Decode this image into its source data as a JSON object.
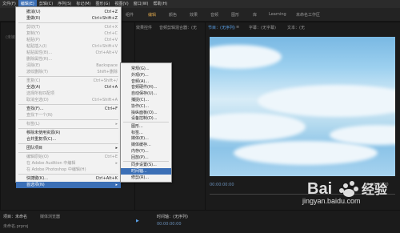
{
  "menubar": [
    "文件(F)",
    "编辑(E)",
    "剪辑(C)",
    "序列(S)",
    "标记(M)",
    "图形(G)",
    "视图(V)",
    "窗口(W)",
    "帮助(H)"
  ],
  "workspace": {
    "tabs": [
      "组件",
      "编辑",
      "颜色",
      "效果",
      "音频",
      "图形",
      "库",
      "Learning",
      "未命名工作区"
    ]
  },
  "panels": {
    "source_tab": "效果控件",
    "audio_mixer_tab": "音频剪辑混合器：(无",
    "program_tab": "节目：(无序列)",
    "program_menu": "≡",
    "subtitle_tab": "字幕：(无字幕)",
    "text_tab": "文本：(无",
    "left_tabs": "(未链接",
    "timecode_left": "00:00:00:00",
    "timecode_right": "00:00:00:00"
  },
  "edit_menu": {
    "items": [
      {
        "label": "撤消(U)",
        "shortcut": "Ctrl+Z",
        "disabled": false
      },
      {
        "label": "重做(R)",
        "shortcut": "Ctrl+Shift+Z",
        "disabled": false
      },
      {
        "sep": true
      },
      {
        "label": "剪切(T)",
        "shortcut": "Ctrl+X",
        "disabled": true
      },
      {
        "label": "复制(Y)",
        "shortcut": "Ctrl+C",
        "disabled": true
      },
      {
        "label": "粘贴(P)",
        "shortcut": "Ctrl+V",
        "disabled": true
      },
      {
        "label": "粘贴插入(I)",
        "shortcut": "Ctrl+Shift+V",
        "disabled": true
      },
      {
        "label": "粘贴属性(B)...",
        "shortcut": "Ctrl+Alt+V",
        "disabled": true
      },
      {
        "label": "删除属性(R)...",
        "shortcut": "",
        "disabled": true
      },
      {
        "label": "清除(E)",
        "shortcut": "Backspace",
        "disabled": true
      },
      {
        "label": "波纹删除(T)",
        "shortcut": "Shift+删除",
        "disabled": true
      },
      {
        "sep": true
      },
      {
        "label": "重复(C)",
        "shortcut": "Ctrl+Shift+/",
        "disabled": true
      },
      {
        "label": "全选(A)",
        "shortcut": "Ctrl+A",
        "disabled": false
      },
      {
        "label": "选择所有匹配项",
        "shortcut": "",
        "disabled": true
      },
      {
        "label": "取消全选(D)",
        "shortcut": "Ctrl+Shift+A",
        "disabled": true
      },
      {
        "sep": true
      },
      {
        "label": "查找(F)...",
        "shortcut": "Ctrl+F",
        "disabled": false
      },
      {
        "label": "查找下一个(N)",
        "shortcut": "",
        "disabled": true
      },
      {
        "sep": true
      },
      {
        "label": "标签(L)",
        "shortcut": "",
        "disabled": true,
        "arrow": true
      },
      {
        "sep": true
      },
      {
        "label": "移除未使用资源(R)",
        "shortcut": "",
        "disabled": false
      },
      {
        "label": "合并重复项(C)...",
        "shortcut": "",
        "disabled": false
      },
      {
        "sep": true
      },
      {
        "label": "团队项目",
        "shortcut": "",
        "disabled": false,
        "arrow": true
      },
      {
        "sep": true
      },
      {
        "label": "编辑原始(O)",
        "shortcut": "Ctrl+E",
        "disabled": true
      },
      {
        "label": "在 Adobe Audition 中编辑",
        "shortcut": "",
        "disabled": true,
        "arrow": true
      },
      {
        "label": "在 Adobe Photoshop 中编辑(H)",
        "shortcut": "",
        "disabled": true
      },
      {
        "sep": true
      },
      {
        "label": "快捷键(K)...",
        "shortcut": "Ctrl+Alt+K",
        "disabled": false
      },
      {
        "label": "首选项(N)",
        "shortcut": "",
        "disabled": false,
        "arrow": true,
        "selected": true
      }
    ]
  },
  "submenu": {
    "items": [
      {
        "label": "常规(G)..."
      },
      {
        "label": "外观(P)..."
      },
      {
        "label": "音频(A)..."
      },
      {
        "label": "音频硬件(H)..."
      },
      {
        "label": "自动保存(U)..."
      },
      {
        "label": "捕捉(C)..."
      },
      {
        "label": "协作(C)..."
      },
      {
        "label": "操纵面板(O)..."
      },
      {
        "label": "设备控制(D)..."
      },
      {
        "label": "图形..."
      },
      {
        "label": "标签..."
      },
      {
        "label": "媒体(E)..."
      },
      {
        "label": "媒体缓存..."
      },
      {
        "label": "内存(Y)..."
      },
      {
        "label": "回放(P)..."
      },
      {
        "label": "同步设置(S)..."
      },
      {
        "label": "时间轴...",
        "selected": true
      },
      {
        "label": "修剪(R)..."
      }
    ]
  },
  "bottom": {
    "project_tab": "项目：未命名",
    "media_tab": "媒体浏览器",
    "project_file": "未命名.prproj",
    "timeline_tab": "时间轴：(无序列)",
    "timecode": "00:00:00:00"
  },
  "watermark": {
    "brand": "Bai",
    "brand_cn": "经验",
    "url": "jingyan.baidu.com"
  },
  "colors": {
    "accent": "#3b6fb6",
    "menu_bg": "#f2f2f2",
    "app_bg": "#1e1e1e"
  }
}
